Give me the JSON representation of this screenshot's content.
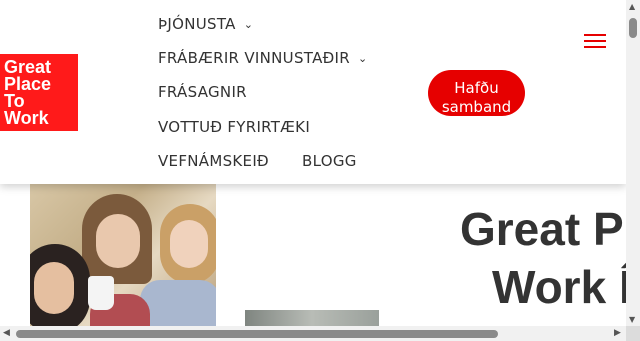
{
  "logo": {
    "lines": [
      "Great",
      "Place",
      "To",
      "Work"
    ],
    "registered": "®",
    "color": "#ff1a1a"
  },
  "nav": {
    "items": [
      {
        "label": "ÞJÓNUSTA",
        "has_dropdown": true
      },
      {
        "label": "FRÁBÆRIR VINNUSTAÐIR",
        "has_dropdown": true
      },
      {
        "label": "FRÁSAGNIR",
        "has_dropdown": false
      },
      {
        "label": "VOTTUÐ FYRIRTÆKI",
        "has_dropdown": false
      },
      {
        "label": "VEFNÁMSKEIÐ",
        "has_dropdown": false
      },
      {
        "label": "BLOGG",
        "has_dropdown": false
      }
    ],
    "chevron": "▼"
  },
  "cta": {
    "line1": "Hafðu",
    "line2": "samband",
    "color": "#e60000"
  },
  "menu_icon": "hamburger-icon",
  "hero": {
    "title_line1": "Great P",
    "title_line2": "Work Í"
  },
  "scroll": {
    "up": "▲",
    "down": "▼",
    "left": "◀",
    "right": "▶"
  }
}
